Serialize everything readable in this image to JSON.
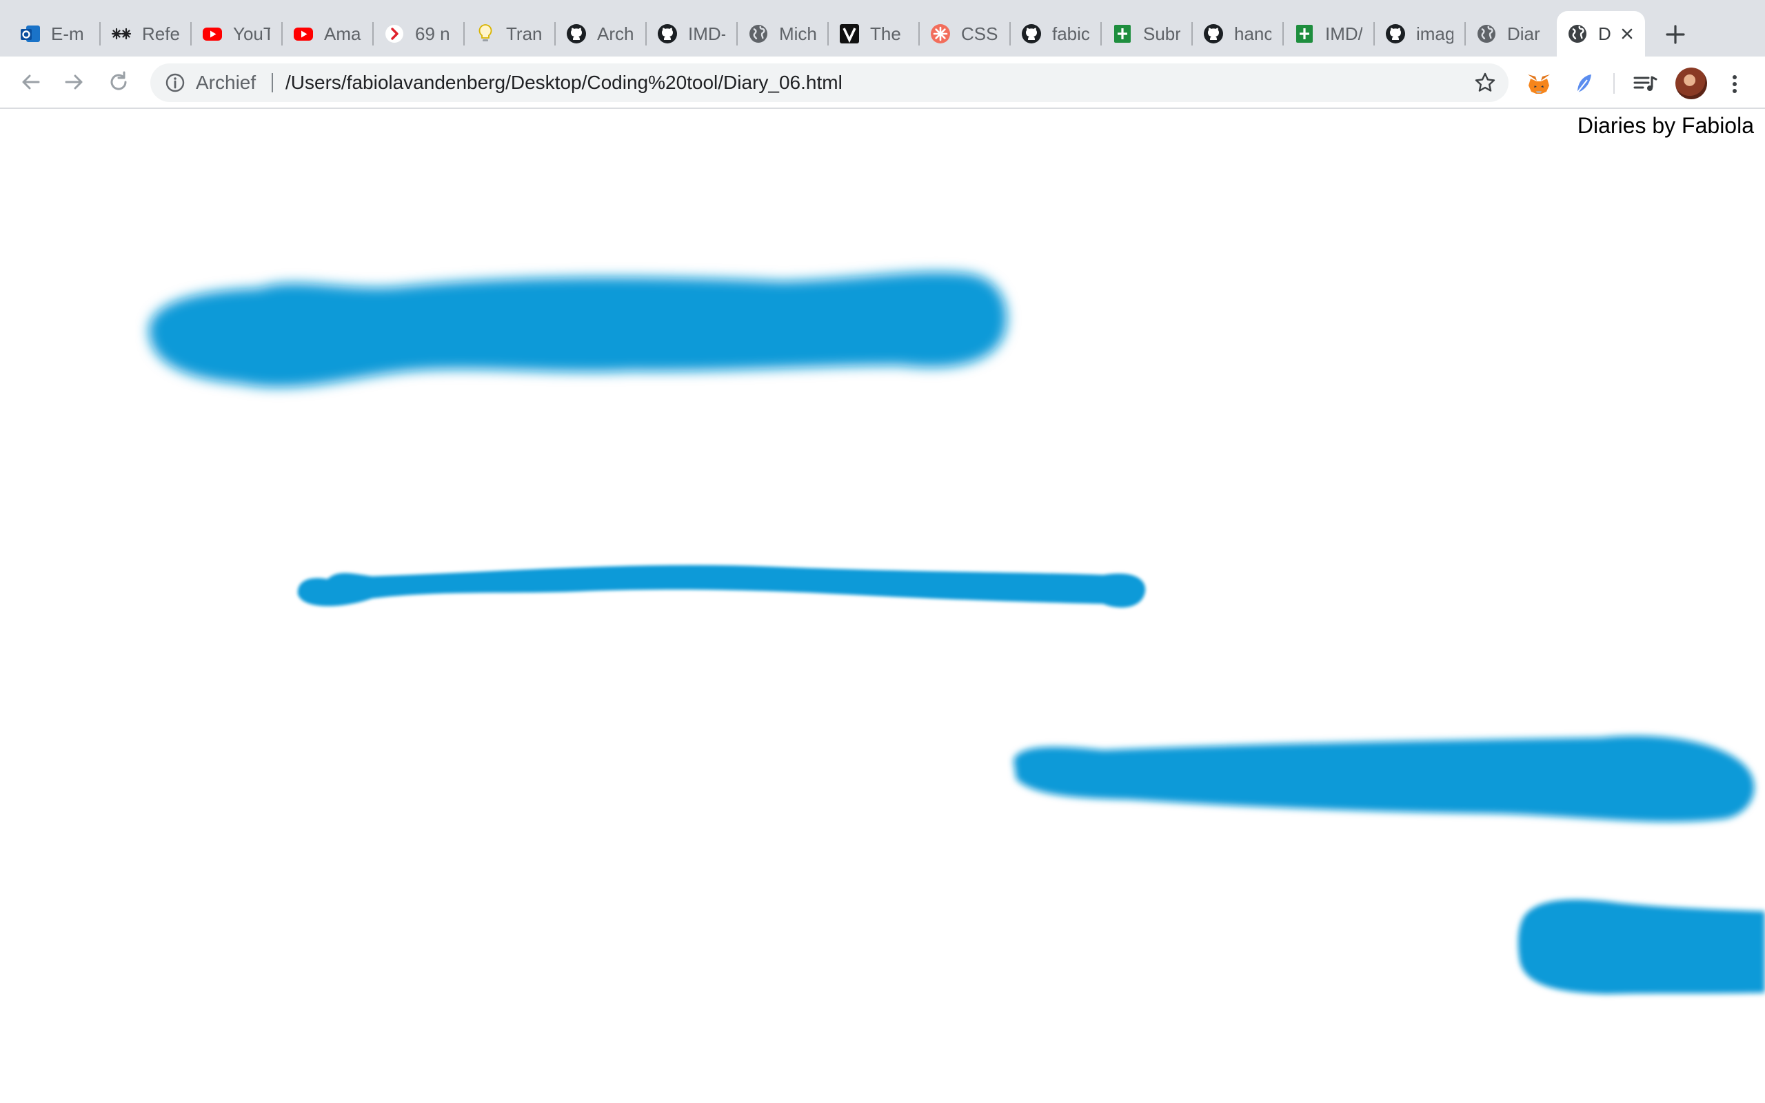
{
  "browser": {
    "tabs": [
      {
        "label": "E-m",
        "icon": "outlook-icon"
      },
      {
        "label": "Refe",
        "icon": "asterisk-icon"
      },
      {
        "label": "YouT",
        "icon": "youtube-icon"
      },
      {
        "label": "Ama",
        "icon": "youtube-icon"
      },
      {
        "label": "69 n",
        "icon": "chevron-badge-icon"
      },
      {
        "label": "Tran",
        "icon": "lightbulb-icon"
      },
      {
        "label": "Arch",
        "icon": "github-icon"
      },
      {
        "label": "IMD-",
        "icon": "github-icon"
      },
      {
        "label": "Mich",
        "icon": "globe-icon"
      },
      {
        "label": "The",
        "icon": "v-logo-icon"
      },
      {
        "label": "CSS",
        "icon": "css-burst-icon"
      },
      {
        "label": "fabic",
        "icon": "github-icon"
      },
      {
        "label": "Subr",
        "icon": "sheets-icon"
      },
      {
        "label": "hanc",
        "icon": "github-icon"
      },
      {
        "label": "IMD/",
        "icon": "sheets-icon"
      },
      {
        "label": "imag",
        "icon": "github-icon"
      },
      {
        "label": "Diar",
        "icon": "globe-icon"
      }
    ],
    "active_tab": {
      "label": "D",
      "icon": "globe-icon"
    },
    "address_bar": {
      "security_chip": "Archief",
      "url": "/Users/fabiolavandenberg/Desktop/Coding%20tool/Diary_06.html"
    },
    "extensions": [
      "metamask-icon",
      "feather-extension-icon",
      "media-controls-icon"
    ]
  },
  "page": {
    "site_title": "Diaries by Fabiola",
    "stroke_color": "#0e9ad8"
  }
}
